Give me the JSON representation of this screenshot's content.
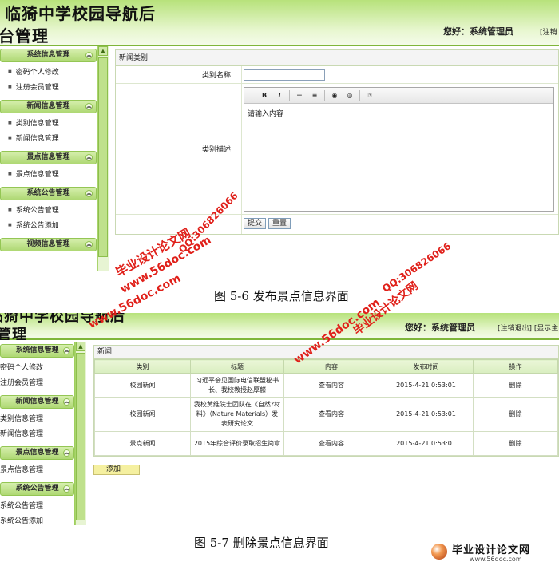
{
  "top_screen": {
    "site_title_line1": "临猗中学校园导航后",
    "site_title_line2": "台管理",
    "greeting": "您好：系统管理员",
    "logout_partial": "[注销",
    "sidebar": [
      {
        "title": "系统信息管理",
        "items": [
          "密码个人修改",
          "注册会员管理"
        ]
      },
      {
        "title": "新闻信息管理",
        "items": [
          "类别信息管理",
          "新闻信息管理"
        ]
      },
      {
        "title": "景点信息管理",
        "items": [
          "景点信息管理"
        ]
      },
      {
        "title": "系统公告管理",
        "items": [
          "系统公告管理",
          "系统公告添加"
        ]
      },
      {
        "title": "视频信息管理",
        "items": []
      }
    ],
    "form": {
      "panel_title": "新闻类别",
      "name_label": "类别名称:",
      "name_value": "",
      "desc_label": "类别描述:",
      "editor_placeholder": "请输入内容",
      "submit_label": "提交",
      "reset_label": "重置"
    }
  },
  "caption1": "图 5-6 发布景点信息界面",
  "bottom_screen": {
    "site_title_line1": "临猗中学校园导航后",
    "site_title_line2": "管理",
    "greeting": "您好：系统管理员",
    "logout_partial": "[注销退出] [显示主",
    "sidebar": [
      {
        "title": "系统信息管理",
        "items": [
          "密码个人修改",
          "注册会员管理"
        ]
      },
      {
        "title": "新闻信息管理",
        "items": [
          "类别信息管理",
          "新闻信息管理"
        ]
      },
      {
        "title": "景点信息管理",
        "items": [
          "景点信息管理"
        ]
      },
      {
        "title": "系统公告管理",
        "items": [
          "系统公告管理",
          "系统公告添加"
        ]
      }
    ],
    "table": {
      "panel_title": "新闻",
      "headers": [
        "类别",
        "标题",
        "内容",
        "发布时间",
        "操作"
      ],
      "rows": [
        {
          "category": "校园新闻",
          "title": "习近平会见国际电信联盟秘书长、我校教授赵厚麟",
          "content": "查看内容",
          "time": "2015-4-21 0:53:01",
          "action": "删除"
        },
        {
          "category": "校园新闻",
          "title": "我校黄维院士团队在《自然?材料》（Nature Materials）发表研究论文",
          "content": "查看内容",
          "time": "2015-4-21 0:53:01",
          "action": "删除"
        },
        {
          "category": "景点新闻",
          "title": "2015年综合评价录取招生简章",
          "content": "查看内容",
          "time": "2015-4-21 0:53:01",
          "action": "删除"
        }
      ],
      "add_label": "添加"
    }
  },
  "caption2": "图 5-7 删除景点信息界面",
  "watermarks": {
    "brand": "毕业设计论文网",
    "url": "www.56doc.com",
    "qq": "QQ:306826066"
  },
  "footer_logo": {
    "text": "毕业设计论文网",
    "url": "www.56doc.com"
  },
  "colors": {
    "banner_green": "#b7e27b",
    "watermark_red": "#e0201a",
    "watermark_yellow": "#d98c00"
  }
}
